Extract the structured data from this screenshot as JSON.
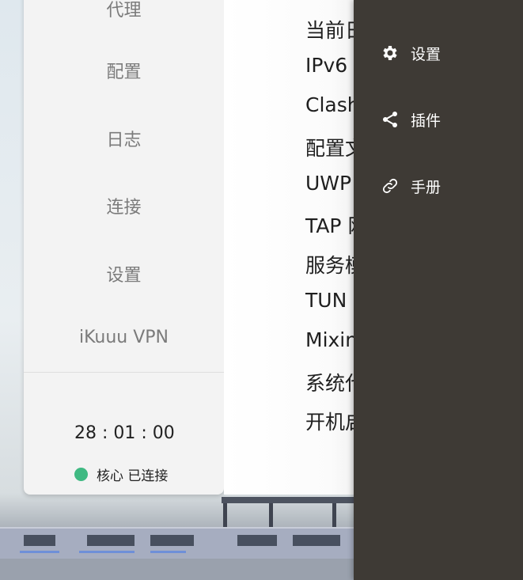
{
  "nav": {
    "items": [
      "代理",
      "配置",
      "日志",
      "连接",
      "设置",
      "iKuuu VPN"
    ],
    "timer": "28 : 01 : 00",
    "status": {
      "label": "核心 已连接",
      "color": "#3fb982"
    }
  },
  "main": {
    "rows": [
      "当前日",
      "IPv6",
      "Clash",
      "配置文",
      "UWP",
      "TAP 网",
      "服务模",
      "TUN",
      "Mixin",
      "系统代",
      "开机启"
    ]
  },
  "flyout": {
    "items": [
      {
        "label": "设置",
        "icon": "gear-icon"
      },
      {
        "label": "插件",
        "icon": "share-icon"
      },
      {
        "label": "手册",
        "icon": "link-icon"
      }
    ]
  }
}
